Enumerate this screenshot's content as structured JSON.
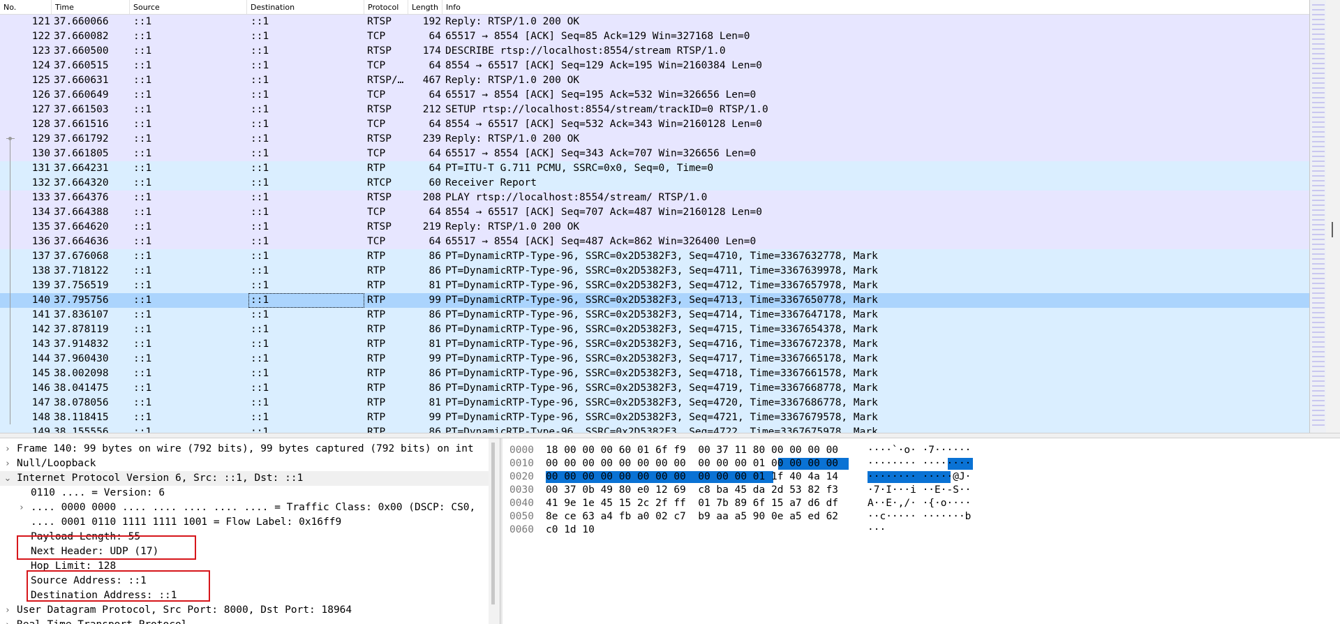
{
  "columns": [
    {
      "key": "no",
      "label": "No."
    },
    {
      "key": "time",
      "label": "Time"
    },
    {
      "key": "source",
      "label": "Source"
    },
    {
      "key": "destination",
      "label": "Destination"
    },
    {
      "key": "protocol",
      "label": "Protocol"
    },
    {
      "key": "length",
      "label": "Length"
    },
    {
      "key": "info",
      "label": "Info"
    }
  ],
  "packets": [
    {
      "no": "121",
      "time": "37.660066",
      "source": "::1",
      "destination": "::1",
      "protocol": "RTSP",
      "length": "192",
      "info": "Reply: RTSP/1.0 200 OK",
      "color": "tcp"
    },
    {
      "no": "122",
      "time": "37.660082",
      "source": "::1",
      "destination": "::1",
      "protocol": "TCP",
      "length": "64",
      "info": "65517 → 8554 [ACK] Seq=85 Ack=129 Win=327168 Len=0",
      "color": "tcp"
    },
    {
      "no": "123",
      "time": "37.660500",
      "source": "::1",
      "destination": "::1",
      "protocol": "RTSP",
      "length": "174",
      "info": "DESCRIBE rtsp://localhost:8554/stream RTSP/1.0",
      "color": "tcp"
    },
    {
      "no": "124",
      "time": "37.660515",
      "source": "::1",
      "destination": "::1",
      "protocol": "TCP",
      "length": "64",
      "info": "8554 → 65517 [ACK] Seq=129 Ack=195 Win=2160384 Len=0",
      "color": "tcp"
    },
    {
      "no": "125",
      "time": "37.660631",
      "source": "::1",
      "destination": "::1",
      "protocol": "RTSP/…",
      "length": "467",
      "info": "Reply: RTSP/1.0 200 OK",
      "color": "tcp"
    },
    {
      "no": "126",
      "time": "37.660649",
      "source": "::1",
      "destination": "::1",
      "protocol": "TCP",
      "length": "64",
      "info": "65517 → 8554 [ACK] Seq=195 Ack=532 Win=326656 Len=0",
      "color": "tcp"
    },
    {
      "no": "127",
      "time": "37.661503",
      "source": "::1",
      "destination": "::1",
      "protocol": "RTSP",
      "length": "212",
      "info": "SETUP rtsp://localhost:8554/stream/trackID=0 RTSP/1.0",
      "color": "tcp"
    },
    {
      "no": "128",
      "time": "37.661516",
      "source": "::1",
      "destination": "::1",
      "protocol": "TCP",
      "length": "64",
      "info": "8554 → 65517 [ACK] Seq=532 Ack=343 Win=2160128 Len=0",
      "color": "tcp"
    },
    {
      "no": "129",
      "time": "37.661792",
      "source": "::1",
      "destination": "::1",
      "protocol": "RTSP",
      "length": "239",
      "info": "Reply: RTSP/1.0 200 OK",
      "color": "tcp"
    },
    {
      "no": "130",
      "time": "37.661805",
      "source": "::1",
      "destination": "::1",
      "protocol": "TCP",
      "length": "64",
      "info": "65517 → 8554 [ACK] Seq=343 Ack=707 Win=326656 Len=0",
      "color": "tcp"
    },
    {
      "no": "131",
      "time": "37.664231",
      "source": "::1",
      "destination": "::1",
      "protocol": "RTP",
      "length": "64",
      "info": "PT=ITU-T G.711 PCMU, SSRC=0x0, Seq=0, Time=0",
      "color": "rtp"
    },
    {
      "no": "132",
      "time": "37.664320",
      "source": "::1",
      "destination": "::1",
      "protocol": "RTCP",
      "length": "60",
      "info": "Receiver Report",
      "color": "rtp"
    },
    {
      "no": "133",
      "time": "37.664376",
      "source": "::1",
      "destination": "::1",
      "protocol": "RTSP",
      "length": "208",
      "info": "PLAY rtsp://localhost:8554/stream/ RTSP/1.0",
      "color": "tcp"
    },
    {
      "no": "134",
      "time": "37.664388",
      "source": "::1",
      "destination": "::1",
      "protocol": "TCP",
      "length": "64",
      "info": "8554 → 65517 [ACK] Seq=707 Ack=487 Win=2160128 Len=0",
      "color": "tcp"
    },
    {
      "no": "135",
      "time": "37.664620",
      "source": "::1",
      "destination": "::1",
      "protocol": "RTSP",
      "length": "219",
      "info": "Reply: RTSP/1.0 200 OK",
      "color": "tcp"
    },
    {
      "no": "136",
      "time": "37.664636",
      "source": "::1",
      "destination": "::1",
      "protocol": "TCP",
      "length": "64",
      "info": "65517 → 8554 [ACK] Seq=487 Ack=862 Win=326400 Len=0",
      "color": "tcp"
    },
    {
      "no": "137",
      "time": "37.676068",
      "source": "::1",
      "destination": "::1",
      "protocol": "RTP",
      "length": "86",
      "info": "PT=DynamicRTP-Type-96, SSRC=0x2D5382F3, Seq=4710, Time=3367632778, Mark",
      "color": "rtp"
    },
    {
      "no": "138",
      "time": "37.718122",
      "source": "::1",
      "destination": "::1",
      "protocol": "RTP",
      "length": "86",
      "info": "PT=DynamicRTP-Type-96, SSRC=0x2D5382F3, Seq=4711, Time=3367639978, Mark",
      "color": "rtp"
    },
    {
      "no": "139",
      "time": "37.756519",
      "source": "::1",
      "destination": "::1",
      "protocol": "RTP",
      "length": "81",
      "info": "PT=DynamicRTP-Type-96, SSRC=0x2D5382F3, Seq=4712, Time=3367657978, Mark",
      "color": "rtp"
    },
    {
      "no": "140",
      "time": "37.795756",
      "source": "::1",
      "destination": "::1",
      "protocol": "RTP",
      "length": "99",
      "info": "PT=DynamicRTP-Type-96, SSRC=0x2D5382F3, Seq=4713, Time=3367650778, Mark",
      "color": "sel"
    },
    {
      "no": "141",
      "time": "37.836107",
      "source": "::1",
      "destination": "::1",
      "protocol": "RTP",
      "length": "86",
      "info": "PT=DynamicRTP-Type-96, SSRC=0x2D5382F3, Seq=4714, Time=3367647178, Mark",
      "color": "rtp"
    },
    {
      "no": "142",
      "time": "37.878119",
      "source": "::1",
      "destination": "::1",
      "protocol": "RTP",
      "length": "86",
      "info": "PT=DynamicRTP-Type-96, SSRC=0x2D5382F3, Seq=4715, Time=3367654378, Mark",
      "color": "rtp"
    },
    {
      "no": "143",
      "time": "37.914832",
      "source": "::1",
      "destination": "::1",
      "protocol": "RTP",
      "length": "81",
      "info": "PT=DynamicRTP-Type-96, SSRC=0x2D5382F3, Seq=4716, Time=3367672378, Mark",
      "color": "rtp"
    },
    {
      "no": "144",
      "time": "37.960430",
      "source": "::1",
      "destination": "::1",
      "protocol": "RTP",
      "length": "99",
      "info": "PT=DynamicRTP-Type-96, SSRC=0x2D5382F3, Seq=4717, Time=3367665178, Mark",
      "color": "rtp"
    },
    {
      "no": "145",
      "time": "38.002098",
      "source": "::1",
      "destination": "::1",
      "protocol": "RTP",
      "length": "86",
      "info": "PT=DynamicRTP-Type-96, SSRC=0x2D5382F3, Seq=4718, Time=3367661578, Mark",
      "color": "rtp"
    },
    {
      "no": "146",
      "time": "38.041475",
      "source": "::1",
      "destination": "::1",
      "protocol": "RTP",
      "length": "86",
      "info": "PT=DynamicRTP-Type-96, SSRC=0x2D5382F3, Seq=4719, Time=3367668778, Mark",
      "color": "rtp"
    },
    {
      "no": "147",
      "time": "38.078056",
      "source": "::1",
      "destination": "::1",
      "protocol": "RTP",
      "length": "81",
      "info": "PT=DynamicRTP-Type-96, SSRC=0x2D5382F3, Seq=4720, Time=3367686778, Mark",
      "color": "rtp"
    },
    {
      "no": "148",
      "time": "38.118415",
      "source": "::1",
      "destination": "::1",
      "protocol": "RTP",
      "length": "99",
      "info": "PT=DynamicRTP-Type-96, SSRC=0x2D5382F3, Seq=4721, Time=3367679578, Mark",
      "color": "rtp"
    },
    {
      "no": "149",
      "time": "38.155556",
      "source": "::1",
      "destination": "::1",
      "protocol": "RTP",
      "length": "86",
      "info": "PT=DynamicRTP-Type-96, SSRC=0x2D5382F3, Seq=4722, Time=3367675978, Mark",
      "color": "rtp"
    }
  ],
  "details": [
    {
      "text": "Frame 140: 99 bytes on wire (792 bits), 99 bytes captured (792 bits) on int",
      "level": 0,
      "toggle": "collapsed",
      "icon": "chevron-right-icon"
    },
    {
      "text": "Null/Loopback",
      "level": 0,
      "toggle": "collapsed",
      "icon": "chevron-right-icon"
    },
    {
      "text": "Internet Protocol Version 6, Src: ::1, Dst: ::1",
      "level": 0,
      "toggle": "expanded",
      "icon": "chevron-down-icon"
    },
    {
      "text": "0110 .... = Version: 6",
      "level": 1,
      "toggle": "none"
    },
    {
      "text": ".... 0000 0000 .... .... .... .... .... = Traffic Class: 0x00 (DSCP: CS0,",
      "level": 1,
      "toggle": "collapsed",
      "icon": "chevron-right-icon"
    },
    {
      "text": ".... 0001 0110 1111 1111 1001 = Flow Label: 0x16ff9",
      "level": 1,
      "toggle": "none"
    },
    {
      "text": "Payload Length: 55",
      "level": 1,
      "toggle": "none"
    },
    {
      "text": "Next Header: UDP (17)",
      "level": 1,
      "toggle": "none"
    },
    {
      "text": "Hop Limit: 128",
      "level": 1,
      "toggle": "none"
    },
    {
      "text": "Source Address: ::1",
      "level": 1,
      "toggle": "none"
    },
    {
      "text": "Destination Address: ::1",
      "level": 1,
      "toggle": "none"
    },
    {
      "text": "User Datagram Protocol, Src Port: 8000, Dst Port: 18964",
      "level": 0,
      "toggle": "collapsed",
      "icon": "chevron-right-icon"
    },
    {
      "text": "Real-Time Transport Protocol",
      "level": 0,
      "toggle": "collapsed",
      "icon": "chevron-right-icon"
    }
  ],
  "bytes": [
    {
      "offset": "0000",
      "hex": "18 00 00 00 60 01 6f f9  00 37 11 80 00 00 00 00",
      "ascii": "····`·o· ·7······"
    },
    {
      "offset": "0010",
      "hex": "00 00 00 00 00 00 00 00  00 00 00 01 00 00 00 00",
      "ascii": "········ ········"
    },
    {
      "offset": "0020",
      "hex": "00 00 00 00 00 00 00 00  00 00 00 01 1f 40 4a 14",
      "ascii": "········ ·····@J·"
    },
    {
      "offset": "0030",
      "hex": "00 37 0b 49 80 e0 12 69  c8 ba 45 da 2d 53 82 f3",
      "ascii": "·7·I···i ··E·-S··"
    },
    {
      "offset": "0040",
      "hex": "41 9e 1e 45 15 2c 2f ff  01 7b 89 6f 15 a7 d6 df",
      "ascii": "A··E·,/· ·{·o····"
    },
    {
      "offset": "0050",
      "hex": "8e ce 63 a4 fb a0 02 c7  b9 aa a5 90 0e a5 ed 62",
      "ascii": "··c····· ·······b"
    },
    {
      "offset": "0060",
      "hex": "c0 1d 10",
      "ascii": "···"
    }
  ],
  "colors": {
    "tcp_row": "#e7e6ff",
    "rtp_row": "#daeeff",
    "selected_row": "#abd4fd",
    "byte_highlight": "#0a72d4",
    "annotation_box": "#d6161b"
  }
}
